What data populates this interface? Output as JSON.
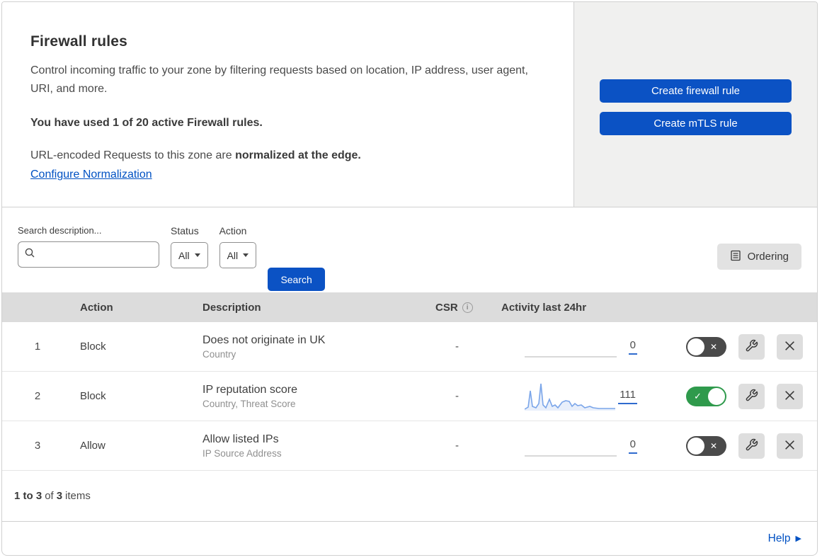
{
  "header": {
    "title": "Firewall rules",
    "description": "Control incoming traffic to your zone by filtering requests based on location, IP address, user agent, URI, and more.",
    "usage_text": "You have used 1 of 20 active Firewall rules.",
    "normalization_text": "URL-encoded Requests to this zone are ",
    "normalization_bold": "normalized at the edge.",
    "normalization_link": "Configure Normalization",
    "create_firewall_button": "Create firewall rule",
    "create_mtls_button": "Create mTLS rule"
  },
  "filters": {
    "search_label": "Search description...",
    "search_value": "",
    "status_label": "Status",
    "status_value": "All",
    "action_label": "Action",
    "action_value": "All",
    "search_button": "Search",
    "ordering_button": "Ordering"
  },
  "table": {
    "columns": {
      "action": "Action",
      "description": "Description",
      "csr": "CSR",
      "activity": "Activity last 24hr"
    },
    "rows": [
      {
        "num": "1",
        "action": "Block",
        "description": "Does not originate in UK",
        "match": "Country",
        "csr": "-",
        "activity_count": "0",
        "enabled": false,
        "has_sparkline": false
      },
      {
        "num": "2",
        "action": "Block",
        "description": "IP reputation score",
        "match": "Country, Threat Score",
        "csr": "-",
        "activity_count": "111",
        "enabled": true,
        "has_sparkline": true
      },
      {
        "num": "3",
        "action": "Allow",
        "description": "Allow listed IPs",
        "match": "IP Source Address",
        "csr": "-",
        "activity_count": "0",
        "enabled": false,
        "has_sparkline": false
      }
    ]
  },
  "chart_data": {
    "type": "line",
    "title": "Activity last 24hr sparkline (rule 2)",
    "x_range": [
      0,
      130
    ],
    "y_range": [
      0,
      42
    ],
    "points": [
      [
        0,
        39
      ],
      [
        5,
        36
      ],
      [
        8,
        13
      ],
      [
        11,
        35
      ],
      [
        16,
        37
      ],
      [
        20,
        31
      ],
      [
        23,
        3
      ],
      [
        26,
        33
      ],
      [
        30,
        37
      ],
      [
        35,
        25
      ],
      [
        39,
        35
      ],
      [
        43,
        33
      ],
      [
        47,
        37
      ],
      [
        53,
        29
      ],
      [
        58,
        27
      ],
      [
        63,
        28
      ],
      [
        67,
        35
      ],
      [
        71,
        31
      ],
      [
        75,
        34
      ],
      [
        80,
        33
      ],
      [
        85,
        37
      ],
      [
        92,
        35
      ],
      [
        97,
        37
      ],
      [
        105,
        38
      ],
      [
        115,
        38
      ],
      [
        128,
        38
      ]
    ],
    "total_label": "111"
  },
  "footer": {
    "range": "1 to 3",
    "of_text": "of",
    "total": "3",
    "items_text": "items"
  },
  "help": {
    "label": "Help"
  },
  "colors": {
    "brand_blue": "#0b52c4",
    "link_blue": "#0051c3",
    "toggle_on_green": "#2f9a4c",
    "toggle_off_gray": "#4a4a4a",
    "table_header_bg": "#dcdcdc",
    "panel_gray": "#f0f0ef",
    "sparkline_blue": "#7aa5e9"
  }
}
